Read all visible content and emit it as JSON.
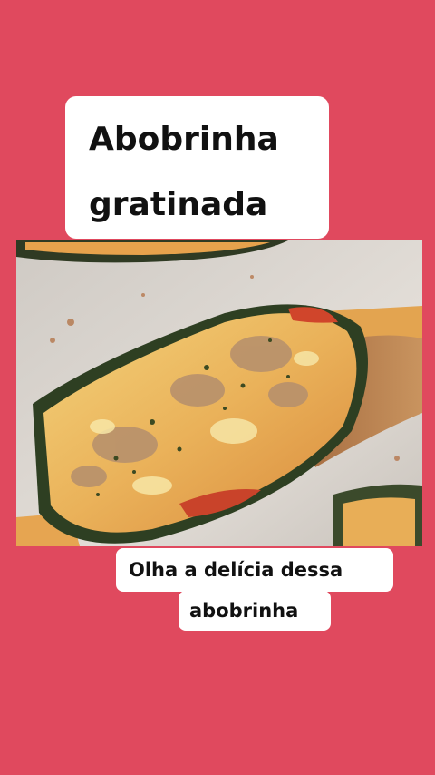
{
  "title": {
    "line1": "Abobrinha",
    "line2": "gratinada"
  },
  "caption": {
    "line1": "Olha a delícia dessa",
    "line2": "abobrinha"
  },
  "photo": {
    "description_icon": "gratin-zucchini-photo"
  },
  "colors": {
    "background": "#E0495E",
    "box": "#FFFFFF",
    "text": "#111111"
  }
}
